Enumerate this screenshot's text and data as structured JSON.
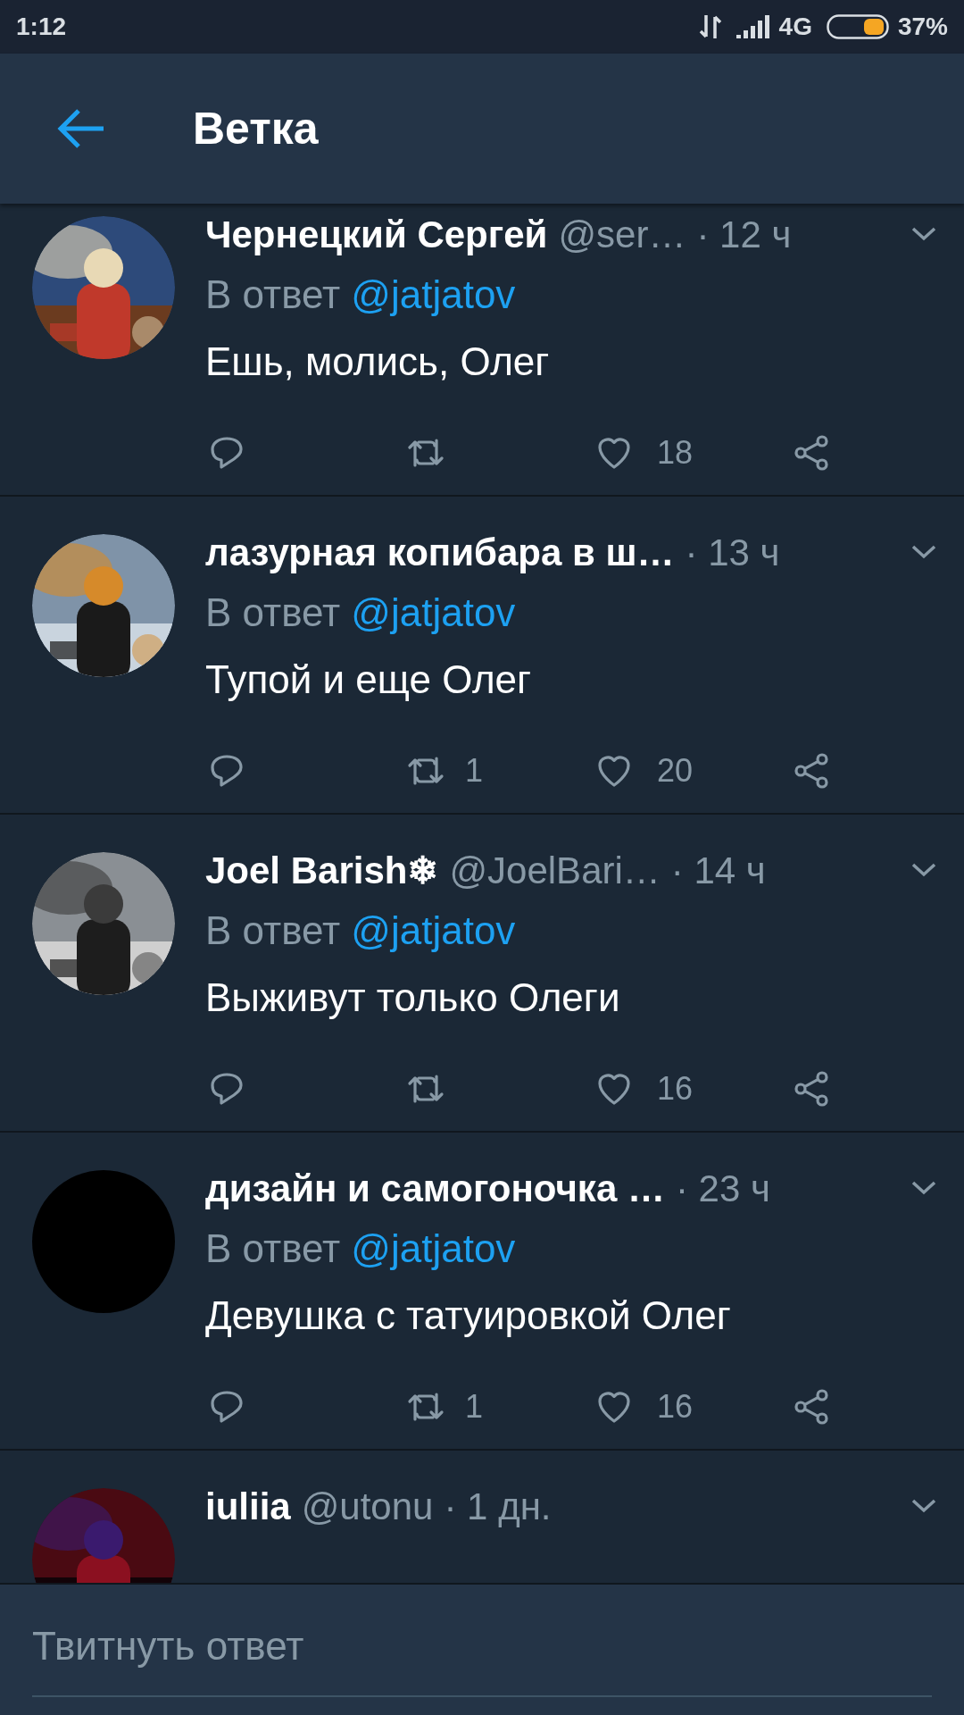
{
  "status_bar": {
    "time": "1:12",
    "network": "4G",
    "battery": "37%"
  },
  "header": {
    "title": "Ветка"
  },
  "tweets": [
    {
      "name": "Чернецкий Сергей",
      "handle": "@ser…",
      "time": "· 12 ч",
      "reply_prefix": "В ответ",
      "reply_to": "@jatjatov",
      "text": "Ешь, молись, Олег",
      "likes": "18"
    },
    {
      "name": "лазурная копибара в ш…",
      "time": "· 13 ч",
      "reply_prefix": "В ответ",
      "reply_to": "@jatjatov",
      "text": "Тупой и еще Олег",
      "retweets": "1",
      "likes": "20"
    },
    {
      "name": "Joel Barish❄",
      "handle": "@JoelBari…",
      "time": "· 14 ч",
      "reply_prefix": "В ответ",
      "reply_to": "@jatjatov",
      "text": "Выживут только Олеги",
      "likes": "16"
    },
    {
      "name": "дизайн и самогоночка …",
      "time": "· 23 ч",
      "reply_prefix": "В ответ",
      "reply_to": "@jatjatov",
      "text": "Девушка с татуировкой Олег",
      "retweets": "1",
      "likes": "16",
      "avatar": {
        "kind": "blank"
      }
    },
    {
      "name": "iuliia",
      "handle": "@utonu",
      "time": "· 1 дн."
    }
  ],
  "reply_bar": {
    "placeholder": "Твитнуть ответ"
  }
}
